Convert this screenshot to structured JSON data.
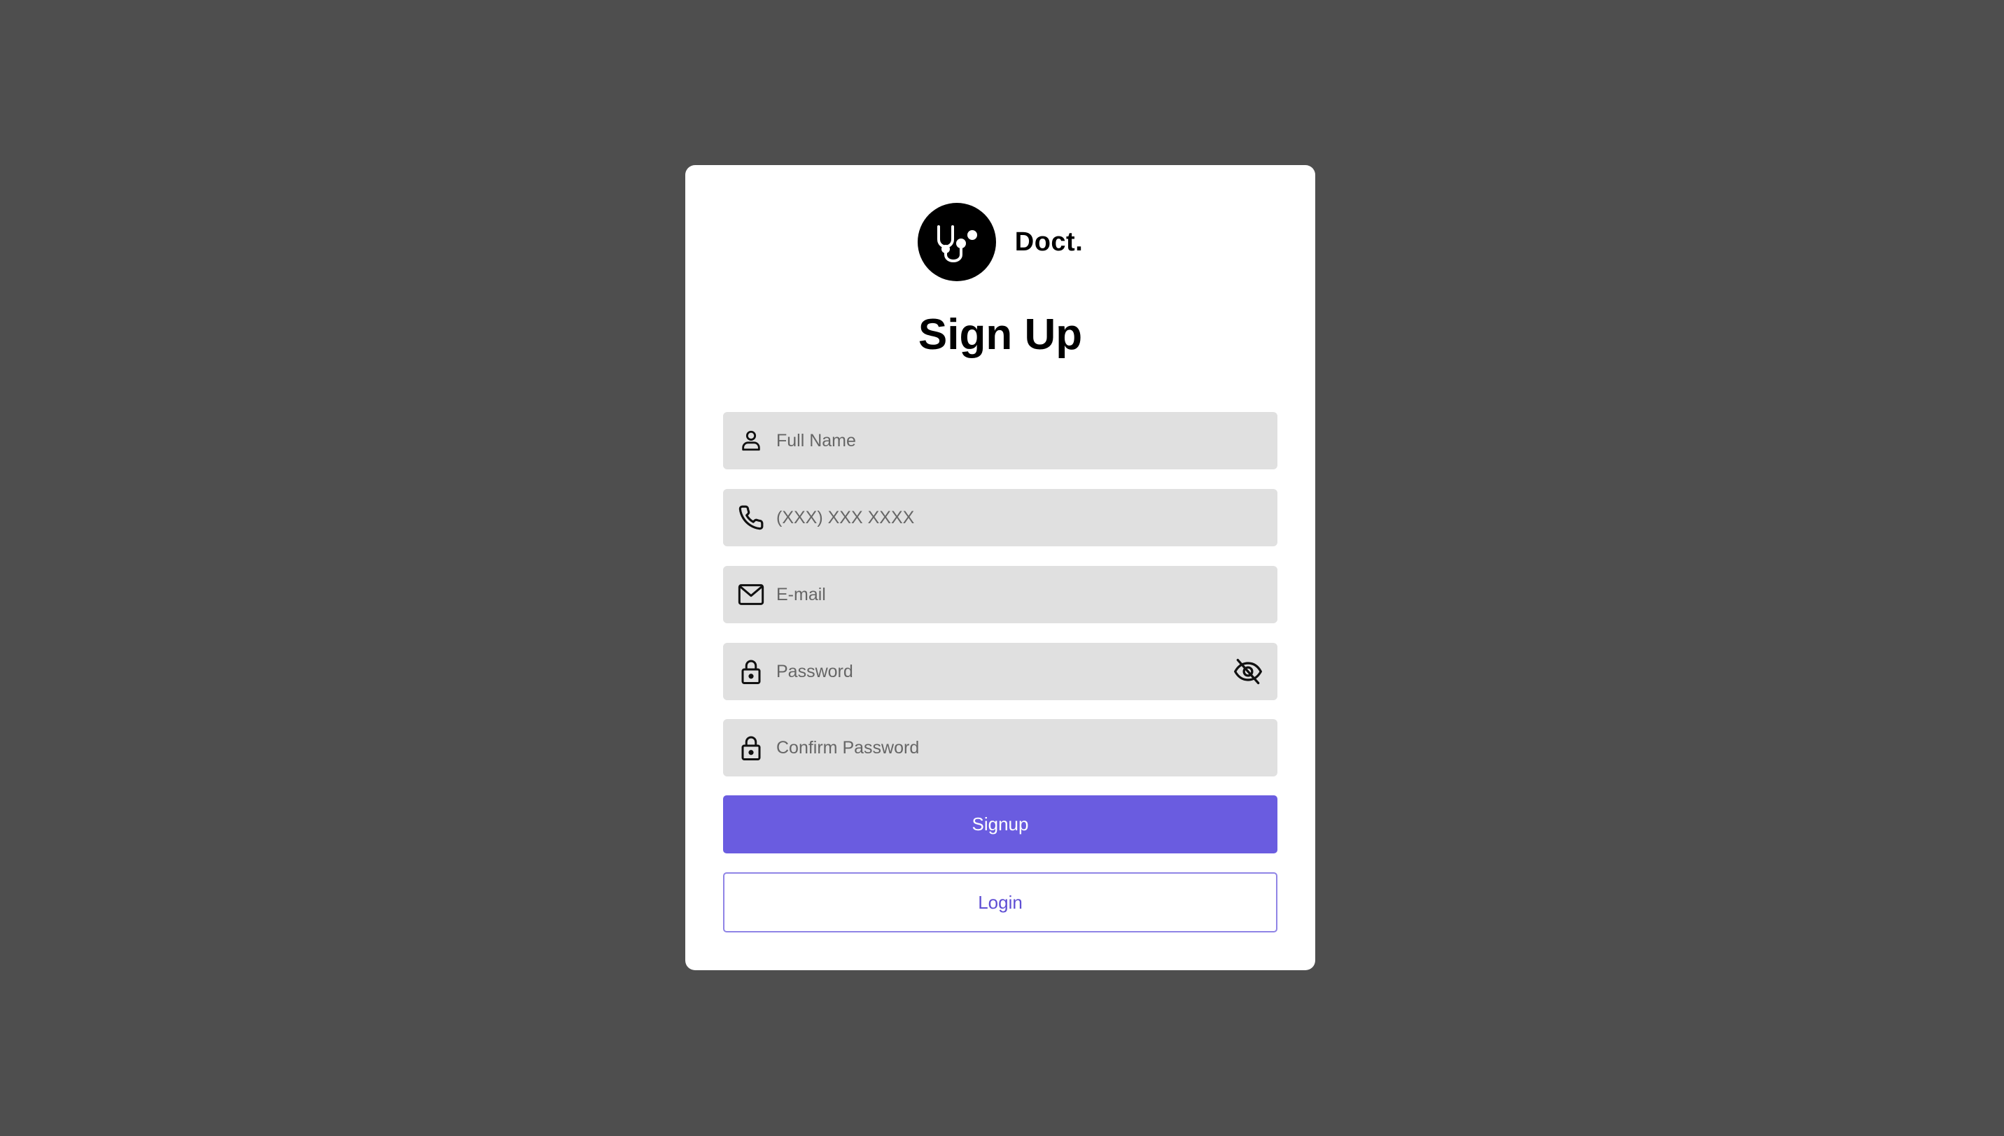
{
  "brand": {
    "name": "Doct.",
    "logo_icon": "stethoscope-icon"
  },
  "title": "Sign Up",
  "fields": [
    {
      "name": "full-name",
      "icon": "person-icon",
      "placeholder": "Full Name",
      "value": ""
    },
    {
      "name": "phone",
      "icon": "phone-icon",
      "placeholder": "(XXX) XXX XXXX",
      "value": ""
    },
    {
      "name": "email",
      "icon": "mail-icon",
      "placeholder": "E-mail",
      "value": ""
    },
    {
      "name": "password",
      "icon": "lock-icon",
      "placeholder": "Password",
      "value": "",
      "toggle_icon": "eye-off-icon"
    },
    {
      "name": "confirm-password",
      "icon": "lock-icon",
      "placeholder": "Confirm Password",
      "value": ""
    }
  ],
  "buttons": {
    "signup_label": "Signup",
    "login_label": "Login"
  },
  "colors": {
    "background": "#4e4e4e",
    "card": "#ffffff",
    "field": "#e0e0e0",
    "primary": "#6a5ce0",
    "login_text": "#5f4fd4"
  }
}
